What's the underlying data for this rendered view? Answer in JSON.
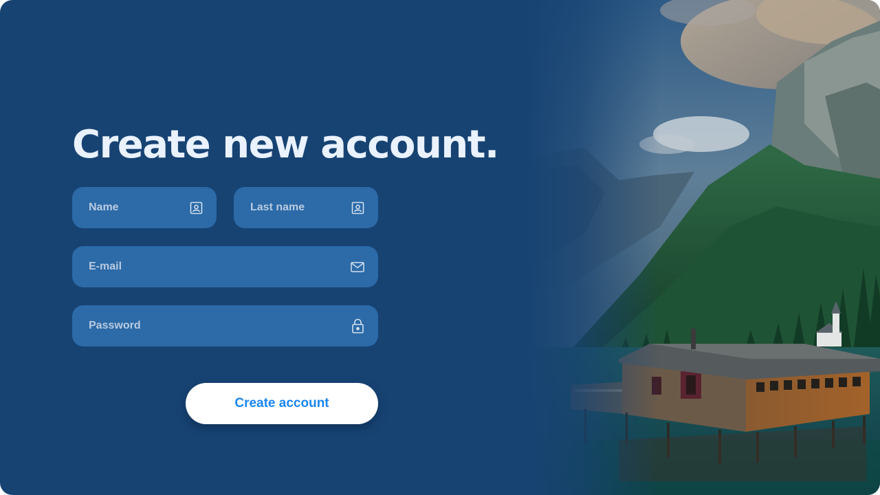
{
  "form": {
    "title": "Create new account.",
    "fields": {
      "first_name": {
        "placeholder": "Name",
        "icon": "contact-card-icon"
      },
      "last_name": {
        "placeholder": "Last name",
        "icon": "contact-card-icon"
      },
      "email": {
        "placeholder": "E-mail",
        "icon": "envelope-icon"
      },
      "password": {
        "placeholder": "Password",
        "icon": "lock-icon"
      }
    },
    "submit_label": "Create account"
  },
  "colors": {
    "background": "#174373",
    "field": "#2c6aa8",
    "title_text": "#eaf2ff",
    "placeholder": "#b9cbe0",
    "button_bg": "#ffffff",
    "button_text": "#1a86f2"
  },
  "image": {
    "subject": "lake-cabin-mountain-landscape"
  }
}
